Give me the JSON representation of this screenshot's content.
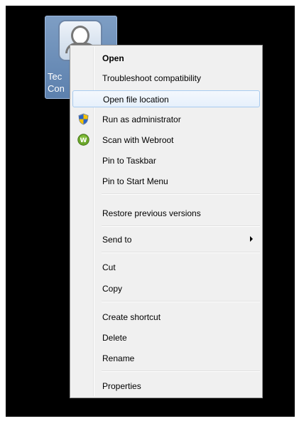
{
  "desktop": {
    "icon_label_line1": "Tec",
    "icon_label_line2": "Con"
  },
  "menu": {
    "items": [
      {
        "label": "Open"
      },
      {
        "label": "Troubleshoot compatibility"
      },
      {
        "label": "Open file location"
      },
      {
        "label": "Run as administrator",
        "icon": "uac-shield-icon"
      },
      {
        "label": "Scan with Webroot",
        "icon": "webroot-icon"
      },
      {
        "label": "Pin to Taskbar"
      },
      {
        "label": "Pin to Start Menu"
      },
      {
        "label": "Restore previous versions"
      },
      {
        "label": "Send to"
      },
      {
        "label": "Cut"
      },
      {
        "label": "Copy"
      },
      {
        "label": "Create shortcut"
      },
      {
        "label": "Delete"
      },
      {
        "label": "Rename"
      },
      {
        "label": "Properties"
      }
    ],
    "highlighted_item": "Open file location",
    "colors": {
      "highlight_border": "#a8cbef",
      "menu_bg": "#f0f0f0"
    }
  }
}
